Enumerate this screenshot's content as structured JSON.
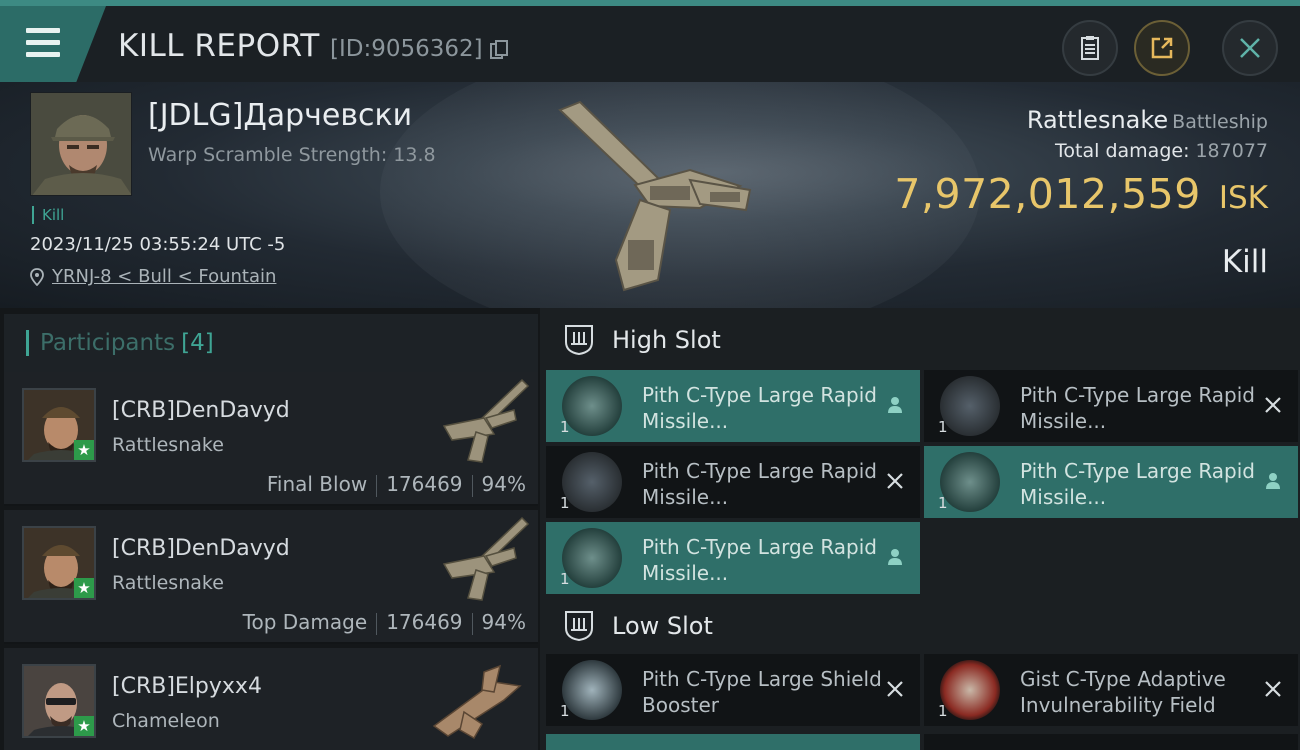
{
  "header": {
    "title": "KILL REPORT",
    "report_id": "[ID:9056362]"
  },
  "victim": {
    "name": "[JDLG]Дарчевски",
    "warp_scramble": "Warp Scramble Strength: 13.8",
    "tag": "Kill",
    "timestamp": "2023/11/25 03:55:24 UTC -5",
    "location": "YRNJ-8 < Bull < Fountain",
    "ship": "Rattlesnake",
    "ship_class": "Battleship",
    "total_damage_label": "Total damage:",
    "total_damage": "187077",
    "isk_value": "7,972,012,559",
    "isk_unit": "ISK",
    "result": "Kill"
  },
  "participants": {
    "title": "Participants",
    "count": "[4]",
    "items": [
      {
        "name": "[CRB]DenDavyd",
        "ship": "Rattlesnake",
        "role": "Final Blow",
        "damage": "176469",
        "percent": "94%"
      },
      {
        "name": "[CRB]DenDavyd",
        "ship": "Rattlesnake",
        "role": "Top Damage",
        "damage": "176469",
        "percent": "94%"
      },
      {
        "name": "[CRB]Elpyxx4",
        "ship": "Chameleon"
      }
    ]
  },
  "fitting": {
    "high_slot": {
      "label": "High Slot",
      "modules": [
        {
          "qty": "1",
          "name": "Pith C-Type Large Rapid Missile...",
          "status": "dropped"
        },
        {
          "qty": "1",
          "name": "Pith C-Type Large Rapid Missile...",
          "status": "destroyed"
        },
        {
          "qty": "1",
          "name": "Pith C-Type Large Rapid Missile...",
          "status": "destroyed"
        },
        {
          "qty": "1",
          "name": "Pith C-Type Large Rapid Missile...",
          "status": "dropped"
        },
        {
          "qty": "1",
          "name": "Pith C-Type Large Rapid Missile...",
          "status": "dropped"
        }
      ]
    },
    "low_slot": {
      "label": "Low Slot",
      "modules": [
        {
          "qty": "1",
          "name": "Pith C-Type Large Shield Booster",
          "status": "destroyed"
        },
        {
          "qty": "1",
          "name": "Gist C-Type Adaptive Invulnerability Field",
          "status": "destroyed"
        }
      ]
    }
  },
  "colors": {
    "accent": "#3fa594",
    "isk": "#e8c66a",
    "dropped_bg": "#2f6f69",
    "destroyed_bg": "#111416",
    "final_blow_badge": "#2d9a4a"
  },
  "icons": [
    "menu-icon",
    "copy-icon",
    "clipboard-icon",
    "share-icon",
    "close-icon",
    "location-pin-icon",
    "slot-icon",
    "person-icon",
    "cross-icon"
  ]
}
